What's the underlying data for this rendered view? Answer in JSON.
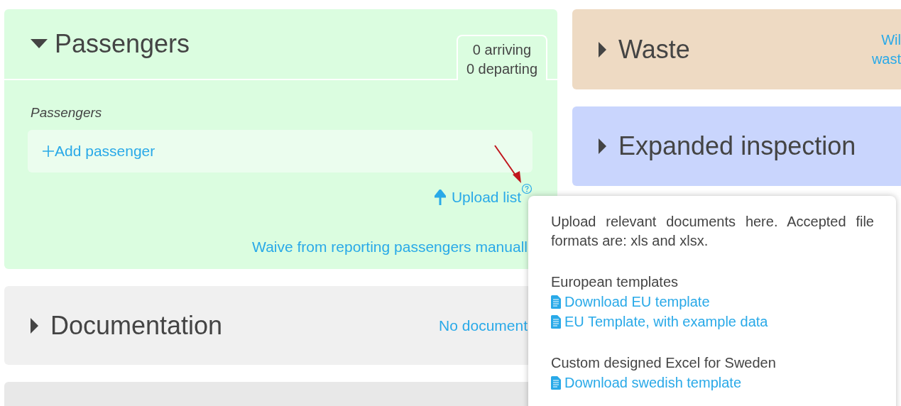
{
  "left_panels": [
    {
      "kind": "passengers",
      "title": "Passengers",
      "expanded": true,
      "color": "#dbfde0",
      "tab_lines": [
        "0 arriving",
        "0 departing"
      ],
      "section_label": "Passengers",
      "add_button": "Add passenger",
      "upload_link": "Upload list",
      "waive_link": "Waive from reporting passengers manuall"
    },
    {
      "kind": "simple",
      "title": "Documentation",
      "expanded": false,
      "color": "#f0f0f0",
      "status_link": "No document"
    },
    {
      "kind": "blank",
      "color": "#e8e8e8"
    }
  ],
  "right_panels": [
    {
      "title": "Waste",
      "expanded": false,
      "color": "#eedac3",
      "side_link_lines": [
        "Wil",
        "wast"
      ]
    },
    {
      "title": "Expanded inspection",
      "expanded": false,
      "color": "#c9d5fd"
    }
  ],
  "popover": {
    "description": "Upload relevant documents here. Accepted file formats are: xls and xlsx.",
    "groups": [
      {
        "heading": "European templates",
        "links": [
          "Download EU template",
          "EU Template, with example data"
        ]
      },
      {
        "heading": "Custom designed Excel for Sweden",
        "links": [
          "Download swedish template"
        ]
      }
    ]
  }
}
